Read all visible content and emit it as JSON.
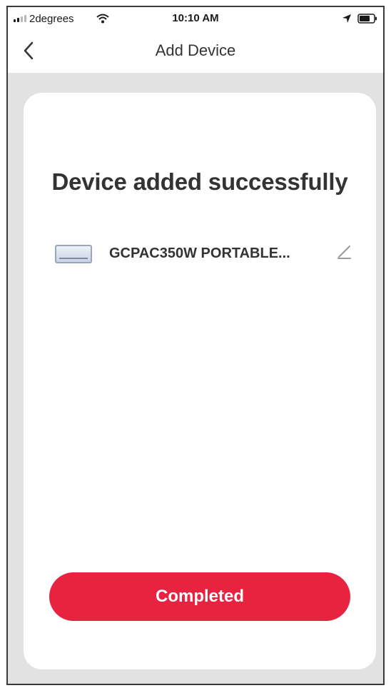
{
  "status_bar": {
    "carrier": "2degrees",
    "time": "10:10 AM",
    "icons": [
      "signal-icon",
      "wifi-icon",
      "location-icon",
      "battery-icon"
    ]
  },
  "nav": {
    "back_icon": "chevron-left-icon",
    "title": "Add Device"
  },
  "main": {
    "headline": "Device added successfully",
    "device": {
      "name": "GCPAC350W PORTABLE...",
      "thumbnail_icon": "air-conditioner-icon",
      "edit_icon": "pencil-icon"
    },
    "completed_label": "Completed"
  },
  "colors": {
    "accent": "#e8233f",
    "page_background": "#e2e2e2",
    "card_background": "#ffffff"
  }
}
